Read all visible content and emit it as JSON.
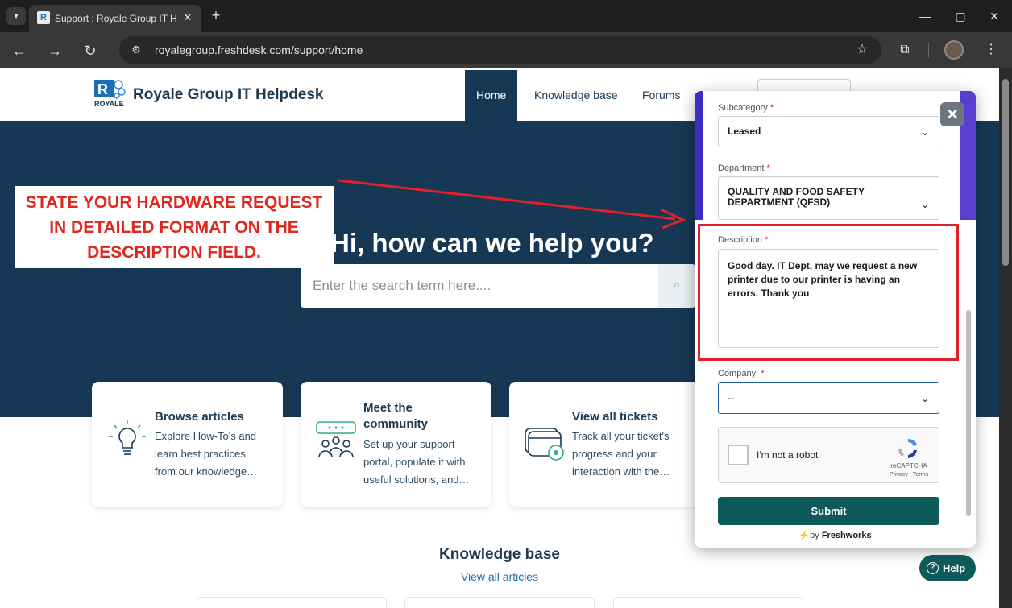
{
  "browser": {
    "tab_title": "Support : Royale Group IT He",
    "url": "royalegroup.freshdesk.com/support/home",
    "tab_list_icon": "chevron-down-icon",
    "new_tab_symbol": "+",
    "close_symbol": "✕"
  },
  "header": {
    "brand": "Royale Group IT Helpdesk",
    "logo_text": "ROYALE",
    "nav": [
      {
        "label": "Home",
        "active": true
      },
      {
        "label": "Knowledge base",
        "active": false
      },
      {
        "label": "Forums",
        "active": false
      }
    ]
  },
  "hero": {
    "title": "Hi, how can we help you?",
    "search_placeholder": "Enter the search term here...."
  },
  "annotation": {
    "line1": "STATE YOUR HARDWARE REQUEST",
    "line2": "IN DETAILED FORMAT ON THE",
    "line3": "DESCRIPTION FIELD.",
    "color": "#e0261f"
  },
  "cards": [
    {
      "title": "Browse articles",
      "desc1": "Explore How-To's and",
      "desc2": "learn best practices",
      "desc3": "from our knowledge…",
      "icon": "lightbulb-icon"
    },
    {
      "title": "Meet the community",
      "title1": "Meet the",
      "title2": "community",
      "desc1": "Set up your support",
      "desc2": "portal, populate it with",
      "desc3": "useful solutions, and…",
      "icon": "community-icon"
    },
    {
      "title": "View all tickets",
      "desc1": "Track all your ticket's",
      "desc2": "progress and your",
      "desc3": "interaction with the…",
      "icon": "tickets-icon"
    }
  ],
  "knowledge_base": {
    "title": "Knowledge base",
    "link": "View all articles"
  },
  "widget": {
    "subcategory": {
      "label": "Subcategory",
      "value": "Leased"
    },
    "department": {
      "label": "Department",
      "value_line1": "QUALITY AND FOOD SAFETY",
      "value_line2": "DEPARTMENT (QFSD)"
    },
    "description": {
      "label": "Description",
      "value_line1": "Good day. IT Dept, may we request a new",
      "value_line2": "printer due to our printer is having an",
      "value_line3": "errors. Thank you"
    },
    "company": {
      "label": "Company:",
      "value": "--"
    },
    "required_mark": "*",
    "captcha": {
      "label": "I'm not a robot",
      "brand": "reCAPTCHA",
      "terms": "Privacy - Terms"
    },
    "submit": "Submit",
    "footer_prefix": "by",
    "footer_brand": "Freshworks",
    "accent_color": "#4a35c9",
    "submit_color": "#0e5a5a"
  },
  "help_button": "Help"
}
